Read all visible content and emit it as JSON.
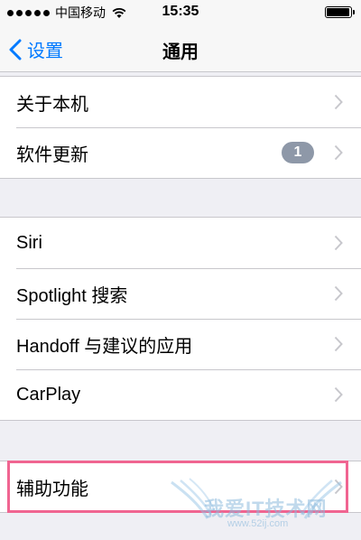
{
  "status_bar": {
    "carrier": "中国移动",
    "time": "15:35",
    "battery_level": 0.95
  },
  "nav": {
    "back_label": "设置",
    "title": "通用"
  },
  "groups": [
    {
      "rows": [
        {
          "label": "关于本机"
        },
        {
          "label": "软件更新",
          "badge": "1"
        }
      ]
    },
    {
      "rows": [
        {
          "label": "Siri"
        },
        {
          "label": "Spotlight 搜索"
        },
        {
          "label": "Handoff 与建议的应用"
        },
        {
          "label": "CarPlay"
        }
      ]
    },
    {
      "rows": [
        {
          "label": "辅助功能"
        }
      ]
    }
  ],
  "watermark": {
    "title": "我爱IT技术网",
    "url": "www.52ij.com"
  },
  "colors": {
    "accent": "#007aff",
    "background": "#efeff4",
    "highlight": "#f06591",
    "badge": "#8e98a8"
  }
}
